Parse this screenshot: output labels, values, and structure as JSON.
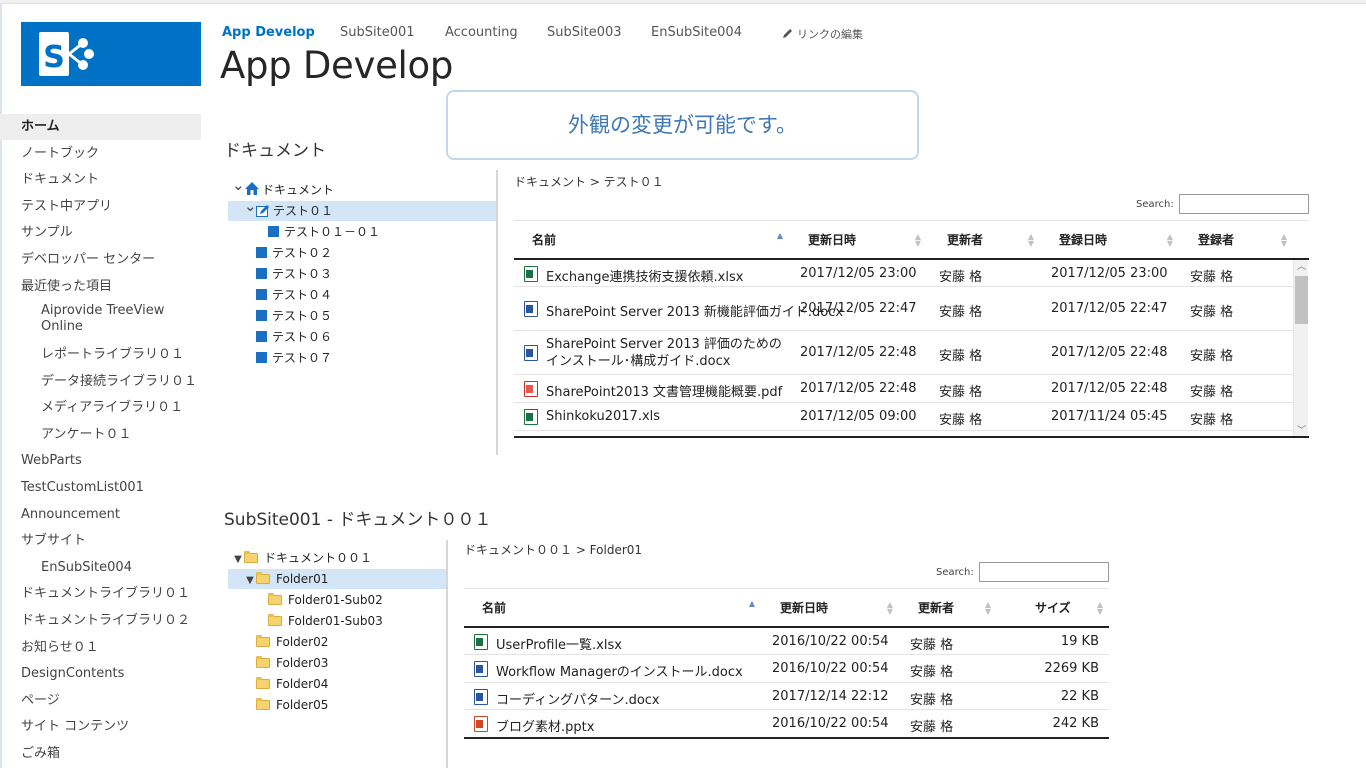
{
  "nav": {
    "items": [
      {
        "label": "App Develop",
        "active": true
      },
      {
        "label": "SubSite001"
      },
      {
        "label": "Accounting"
      },
      {
        "label": "SubSite003"
      },
      {
        "label": "EnSubSite004"
      }
    ],
    "edit_links": "リンクの編集"
  },
  "site_title": "App Develop",
  "notice": "外観の変更が可能です。",
  "leftnav": [
    {
      "label": "ホーム",
      "selected": true
    },
    {
      "label": "ノートブック"
    },
    {
      "label": "ドキュメント"
    },
    {
      "label": "テスト中アプリ"
    },
    {
      "label": "サンプル"
    },
    {
      "label": "デベロッパー センター"
    },
    {
      "label": "最近使った項目"
    },
    {
      "label": "Aiprovide TreeView Online",
      "sub": true
    },
    {
      "label": "レポートライブラリ０１",
      "sub": true
    },
    {
      "label": "データ接続ライブラリ０１",
      "sub": true
    },
    {
      "label": "メディアライブラリ０１",
      "sub": true
    },
    {
      "label": "アンケート０１",
      "sub": true
    },
    {
      "label": "WebParts"
    },
    {
      "label": "TestCustomList001"
    },
    {
      "label": "Announcement"
    },
    {
      "label": "サブサイト"
    },
    {
      "label": "EnSubSite004",
      "sub": true
    },
    {
      "label": "ドキュメントライブラリ０１"
    },
    {
      "label": "ドキュメントライブラリ０２"
    },
    {
      "label": "お知らせ０１"
    },
    {
      "label": "DesignContents"
    },
    {
      "label": "ページ"
    },
    {
      "label": "サイト コンテンツ"
    },
    {
      "label": "ごみ箱"
    }
  ],
  "section1": {
    "title": "ドキュメント",
    "tree": [
      {
        "label": "ドキュメント",
        "level": 0,
        "icon": "home-icon",
        "expanded": true
      },
      {
        "label": "テスト０１",
        "level": 1,
        "icon": "edit-folder-icon",
        "expanded": true,
        "selected": true
      },
      {
        "label": "テスト０１－０１",
        "level": 2,
        "icon": "square-icon"
      },
      {
        "label": "テスト０２",
        "level": 1,
        "icon": "square-icon"
      },
      {
        "label": "テスト０３",
        "level": 1,
        "icon": "square-icon"
      },
      {
        "label": "テスト０４",
        "level": 1,
        "icon": "square-icon"
      },
      {
        "label": "テスト０５",
        "level": 1,
        "icon": "square-icon"
      },
      {
        "label": "テスト０６",
        "level": 1,
        "icon": "square-icon"
      },
      {
        "label": "テスト０７",
        "level": 1,
        "icon": "square-icon"
      }
    ],
    "breadcrumb": "ドキュメント > テスト０１",
    "search_label": "Search:",
    "columns": [
      "名前",
      "更新日時",
      "更新者",
      "登録日時",
      "登録者"
    ],
    "rows": [
      {
        "type": "xlsx",
        "name": "Exchange連携技術支援依頼.xlsx",
        "modified": "2017/12/05 23:00",
        "editor": "安藤 格",
        "created": "2017/12/05 23:00",
        "author": "安藤 格"
      },
      {
        "type": "docx",
        "name": "SharePoint Server 2013 新機能評価ガイド.docx",
        "modified": "2017/12/05 22:47",
        "editor": "安藤 格",
        "created": "2017/12/05 22:47",
        "author": "安藤 格"
      },
      {
        "type": "docx",
        "name": "SharePoint Server 2013 評価のためのインストール･構成ガイド.docx",
        "modified": "2017/12/05 22:48",
        "editor": "安藤 格",
        "created": "2017/12/05 22:48",
        "author": "安藤 格"
      },
      {
        "type": "pdf",
        "name": "SharePoint2013 文書管理機能概要.pdf",
        "modified": "2017/12/05 22:48",
        "editor": "安藤 格",
        "created": "2017/12/05 22:48",
        "author": "安藤 格"
      },
      {
        "type": "xlsx",
        "name": "Shinkoku2017.xls",
        "modified": "2017/12/05 09:00",
        "editor": "安藤 格",
        "created": "2017/11/24 05:45",
        "author": "安藤 格"
      }
    ]
  },
  "section2": {
    "title": "SubSite001 - ドキュメント００１",
    "tree": [
      {
        "label": "ドキュメント００１",
        "level": 0,
        "expanded": true
      },
      {
        "label": "Folder01",
        "level": 1,
        "expanded": true,
        "selected": true
      },
      {
        "label": "Folder01-Sub02",
        "level": 2
      },
      {
        "label": "Folder01-Sub03",
        "level": 2
      },
      {
        "label": "Folder02",
        "level": 1
      },
      {
        "label": "Folder03",
        "level": 1
      },
      {
        "label": "Folder04",
        "level": 1
      },
      {
        "label": "Folder05",
        "level": 1
      }
    ],
    "breadcrumb": "ドキュメント００１ > Folder01",
    "search_label": "Search:",
    "columns": [
      "名前",
      "更新日時",
      "更新者",
      "サイズ"
    ],
    "rows": [
      {
        "type": "xlsx",
        "name": "UserProfile一覧.xlsx",
        "modified": "2016/10/22 00:54",
        "editor": "安藤 格",
        "size": "19 KB"
      },
      {
        "type": "docx",
        "name": "Workflow Managerのインストール.docx",
        "modified": "2016/10/22 00:54",
        "editor": "安藤 格",
        "size": "2269 KB"
      },
      {
        "type": "docx",
        "name": "コーディングパターン.docx",
        "modified": "2017/12/14 22:12",
        "editor": "安藤 格",
        "size": "22 KB"
      },
      {
        "type": "pptx",
        "name": "ブログ素材.pptx",
        "modified": "2016/10/22 00:54",
        "editor": "安藤 格",
        "size": "242 KB"
      }
    ]
  },
  "colors": {
    "brand": "#0072c6",
    "tree_selected": "#d2e6f7",
    "notice_border": "#c4d7ea",
    "notice_text": "#3e77b7"
  }
}
